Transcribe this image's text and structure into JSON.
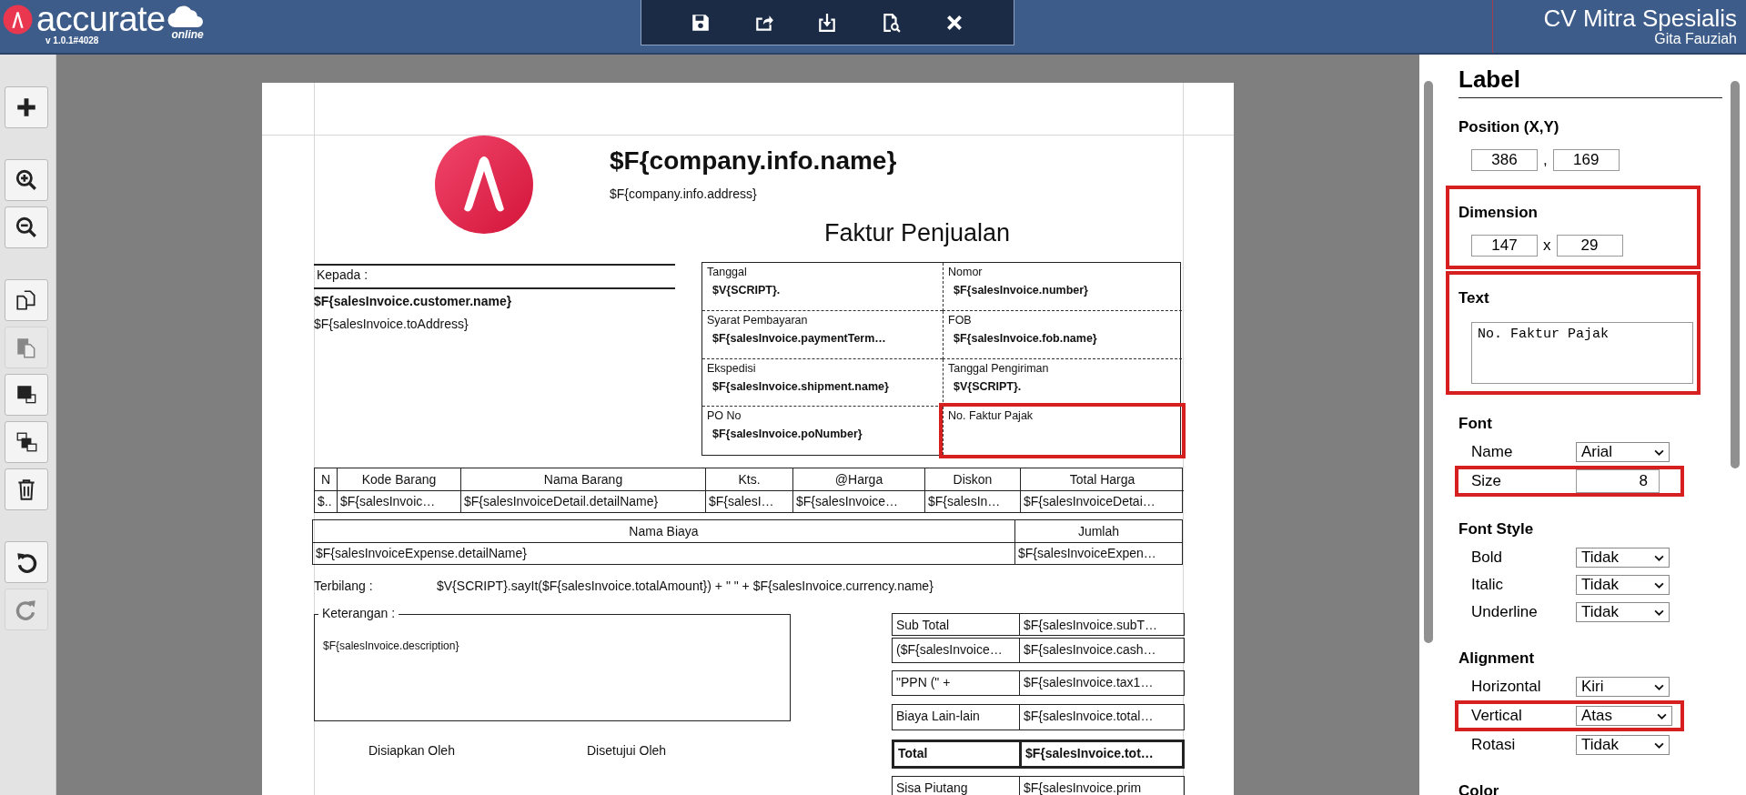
{
  "header": {
    "brand": "accurate",
    "brand_sub": "online",
    "version": "v 1.0.1#4028",
    "company": "CV Mitra Spesialis",
    "user": "Gita Fauziah"
  },
  "top_tools": [
    {
      "kind": "save"
    },
    {
      "kind": "export"
    },
    {
      "kind": "import"
    },
    {
      "kind": "preview"
    },
    {
      "kind": "close"
    }
  ],
  "side_tools": [
    {
      "kind": "add",
      "disabled": false
    },
    {
      "kind": "zoom-in",
      "disabled": false
    },
    {
      "kind": "zoom-out",
      "disabled": false
    },
    {
      "kind": "copy",
      "disabled": false
    },
    {
      "kind": "paste",
      "disabled": true
    },
    {
      "kind": "bring-front",
      "disabled": false
    },
    {
      "kind": "send-back",
      "disabled": false
    },
    {
      "kind": "delete",
      "disabled": false
    },
    {
      "kind": "undo",
      "disabled": false
    },
    {
      "kind": "redo",
      "disabled": true
    }
  ],
  "document": {
    "company_name": "$F{company.info.name}",
    "company_address": "$F{company.info.address}",
    "title": "Faktur Penjualan",
    "recipient": {
      "label": "Kepada :",
      "name": "$F{salesInvoice.customer.name}",
      "address": "$F{salesInvoice.toAddress}"
    },
    "info_cells": [
      {
        "label": "Tanggal",
        "value": "$V{SCRIPT}.",
        "selected": false
      },
      {
        "label": "Nomor",
        "value": "$F{salesInvoice.number}",
        "selected": false
      },
      {
        "label": "Syarat Pembayaran",
        "value": "$F{salesInvoice.paymentTerm…",
        "selected": false
      },
      {
        "label": "FOB",
        "value": "$F{salesInvoice.fob.name}",
        "selected": false
      },
      {
        "label": "Ekspedisi",
        "value": "$F{salesInvoice.shipment.name}",
        "selected": false
      },
      {
        "label": "Tanggal Pengiriman",
        "value": "$V{SCRIPT}.",
        "selected": false
      },
      {
        "label": "PO No",
        "value": "$F{salesInvoice.poNumber}",
        "selected": false
      },
      {
        "label": "No. Faktur Pajak",
        "selected": true
      }
    ],
    "items_table": {
      "columns": [
        "N",
        "Kode Barang",
        "Nama Barang",
        "Kts.",
        "@Harga",
        "Diskon",
        "Total Harga"
      ],
      "row": [
        "$..",
        "$F{salesInvoic…",
        "$F{salesInvoiceDetail.detailName}",
        "$F{salesI…",
        "$F{salesInvoice…",
        "$F{salesIn…",
        "$F{salesInvoiceDetai…"
      ]
    },
    "expense_table": {
      "columns": [
        "Nama Biaya",
        "Jumlah"
      ],
      "row": [
        "$F{salesInvoiceExpense.detailName}",
        "$F{salesInvoiceExpen…"
      ]
    },
    "amount_in_words": {
      "label": "Terbilang :",
      "value": "$V{SCRIPT}.sayIt($F{salesInvoice.totalAmount}) + \" \" + $F{salesInvoice.currency.name}"
    },
    "notes": {
      "label": "Keterangan :",
      "value": "$F{salesInvoice.description}"
    },
    "signatures": [
      "Disiapkan Oleh",
      "Disetujui Oleh"
    ],
    "totals": [
      {
        "label": "Sub Total",
        "value": "$F{salesInvoice.subT…",
        "bold": false
      },
      {
        "label": "($F{salesInvoice…",
        "value": "$F{salesInvoice.cash…",
        "bold": false
      },
      {
        "label": "\"PPN (\" +",
        "value": "$F{salesInvoice.tax1…",
        "bold": false
      },
      {
        "label": "Biaya Lain-lain",
        "value": "$F{salesInvoice.total…",
        "bold": false
      },
      {
        "label": "Total",
        "value": "$F{salesInvoice.tot…",
        "bold": true
      },
      {
        "label": "Sisa Piutang",
        "value": "$F{salesInvoice.prim",
        "bold": false
      }
    ]
  },
  "properties": {
    "title": "Label",
    "sections": [
      {
        "heading": "Position (X,Y)",
        "kind": "pair",
        "values": [
          "386",
          "169"
        ],
        "separator": ",",
        "highlighted": false
      },
      {
        "heading": "Dimension",
        "kind": "pair",
        "values": [
          "147",
          "29"
        ],
        "separator": "x",
        "highlighted": true
      },
      {
        "heading": "Text",
        "kind": "textarea",
        "value": "No. Faktur Pajak",
        "highlighted": true
      },
      {
        "heading": "Font",
        "kind": "fields",
        "highlighted": false,
        "fields": [
          {
            "label": "Name",
            "kind": "select",
            "value": "Arial",
            "highlighted": false
          },
          {
            "label": "Size",
            "kind": "number",
            "value": "8",
            "highlighted": true
          }
        ]
      },
      {
        "heading": "Font Style",
        "kind": "fields",
        "highlighted": false,
        "fields": [
          {
            "label": "Bold",
            "kind": "select",
            "value": "Tidak",
            "highlighted": false
          },
          {
            "label": "Italic",
            "kind": "select",
            "value": "Tidak",
            "highlighted": false
          },
          {
            "label": "Underline",
            "kind": "select",
            "value": "Tidak",
            "highlighted": false
          }
        ]
      },
      {
        "heading": "Alignment",
        "kind": "fields",
        "highlighted": false,
        "fields": [
          {
            "label": "Horizontal",
            "kind": "select",
            "value": "Kiri",
            "highlighted": false
          },
          {
            "label": "Vertical",
            "kind": "select",
            "value": "Atas",
            "highlighted": true
          },
          {
            "label": "Rotasi",
            "kind": "select",
            "value": "Tidak",
            "highlighted": false
          }
        ]
      },
      {
        "heading": "Color",
        "kind": "heading",
        "highlighted": false
      }
    ]
  }
}
